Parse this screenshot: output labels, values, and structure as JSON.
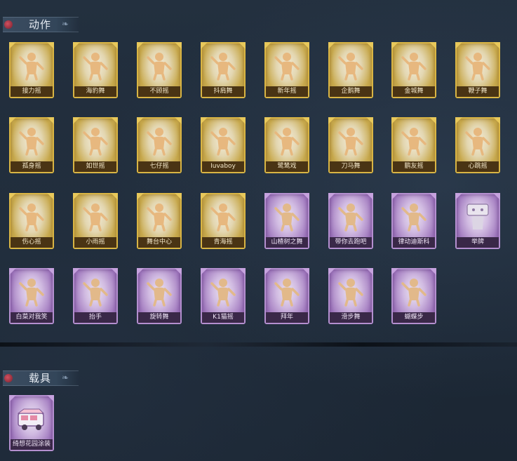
{
  "sections": [
    {
      "title": "动作",
      "items": [
        {
          "label": "接力摇",
          "rarity": "gold",
          "icon": "pose-figure-icon"
        },
        {
          "label": "海豹舞",
          "rarity": "gold",
          "icon": "pose-figure-icon"
        },
        {
          "label": "不顾摇",
          "rarity": "gold",
          "icon": "pose-figure-icon"
        },
        {
          "label": "抖肩舞",
          "rarity": "gold",
          "icon": "pose-figure-icon"
        },
        {
          "label": "新年摇",
          "rarity": "gold",
          "icon": "pose-figure-icon"
        },
        {
          "label": "企鹅舞",
          "rarity": "gold",
          "icon": "pose-figure-icon"
        },
        {
          "label": "金城舞",
          "rarity": "gold",
          "icon": "pose-figure-icon"
        },
        {
          "label": "鞭子舞",
          "rarity": "gold",
          "icon": "pose-figure-icon"
        },
        {
          "label": "孤身摇",
          "rarity": "gold",
          "icon": "pose-figure-icon"
        },
        {
          "label": "如世摇",
          "rarity": "gold",
          "icon": "pose-figure-icon"
        },
        {
          "label": "七仔摇",
          "rarity": "gold",
          "icon": "pose-figure-icon"
        },
        {
          "label": "Iuvaboy",
          "rarity": "gold",
          "icon": "pose-figure-icon"
        },
        {
          "label": "鹭鸶戏",
          "rarity": "gold",
          "icon": "pose-figure-icon"
        },
        {
          "label": "刀马舞",
          "rarity": "gold",
          "icon": "pose-figure-icon"
        },
        {
          "label": "鹏友摇",
          "rarity": "gold",
          "icon": "pose-figure-icon"
        },
        {
          "label": "心跳摇",
          "rarity": "gold",
          "icon": "pose-figure-icon"
        },
        {
          "label": "伤心摇",
          "rarity": "gold",
          "icon": "pose-figure-icon"
        },
        {
          "label": "小雨摇",
          "rarity": "gold",
          "icon": "pose-figure-icon"
        },
        {
          "label": "舞台中心",
          "rarity": "gold",
          "icon": "pose-figure-icon"
        },
        {
          "label": "青海摇",
          "rarity": "gold",
          "icon": "pose-figure-icon"
        },
        {
          "label": "山楂树之舞",
          "rarity": "purple",
          "icon": "pose-figure-icon"
        },
        {
          "label": "带你去跑吧",
          "rarity": "purple",
          "icon": "pose-figure-icon"
        },
        {
          "label": "律动迪斯科",
          "rarity": "purple",
          "icon": "pose-figure-icon"
        },
        {
          "label": "举牌",
          "rarity": "purple",
          "icon": "sign-figure-icon"
        },
        {
          "label": "白菜对我笑",
          "rarity": "purple",
          "icon": "pose-figure-icon"
        },
        {
          "label": "抬手",
          "rarity": "purple",
          "icon": "pose-figure-icon"
        },
        {
          "label": "旋转舞",
          "rarity": "purple",
          "icon": "pose-figure-icon"
        },
        {
          "label": "K1猫摇",
          "rarity": "purple",
          "icon": "pose-figure-icon"
        },
        {
          "label": "拜年",
          "rarity": "purple",
          "icon": "pose-figure-icon"
        },
        {
          "label": "滑步舞",
          "rarity": "purple",
          "icon": "pose-figure-icon"
        },
        {
          "label": "蝴蝶步",
          "rarity": "purple",
          "icon": "pose-figure-icon"
        }
      ]
    },
    {
      "title": "载具",
      "items": [
        {
          "label": "绮想花园涂装",
          "rarity": "purple",
          "icon": "vehicle-icon"
        }
      ]
    }
  ],
  "colors": {
    "gold_frame": "#d9b544",
    "purple_frame": "#b48fcf",
    "background": "#1f2b39"
  }
}
